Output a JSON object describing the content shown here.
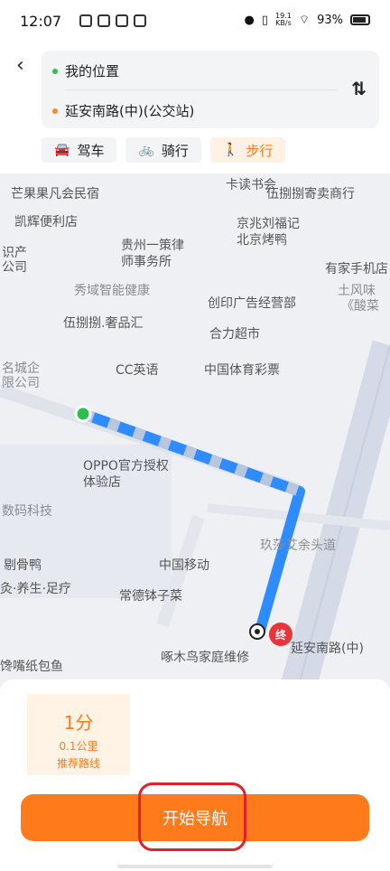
{
  "status_bar": {
    "time": "12:07",
    "net_speed": "19.1\nKB/s",
    "battery": "93%"
  },
  "header": {
    "back_icon": "chevron-left-icon",
    "start": "我的位置",
    "end": "延安南路(中)(公交站)",
    "swap_icon": "swap-icon",
    "modes": [
      {
        "label": "驾车",
        "icon": "car-icon"
      },
      {
        "label": "骑行",
        "icon": "bike-icon"
      },
      {
        "label": "步行",
        "icon": "walk-icon"
      }
    ],
    "active_mode": "步行"
  },
  "map": {
    "pois": [
      {
        "label": "芒果果凡会民宿"
      },
      {
        "label": "卡读书会"
      },
      {
        "label": "伍捌捌寄卖商行"
      },
      {
        "label": "凯辉便利店"
      },
      {
        "label": "京兆刘福记"
      },
      {
        "label": "北京烤鸭"
      },
      {
        "label": "贵州一策律"
      },
      {
        "label": "师事务所"
      },
      {
        "label": "识产"
      },
      {
        "label": "公司"
      },
      {
        "label": "有家手机店"
      },
      {
        "label": "秀域智能健康"
      },
      {
        "label": "土风味"
      },
      {
        "label": "《酸菜"
      },
      {
        "label": "创印广告经营部"
      },
      {
        "label": "伍捌捌.奢品汇"
      },
      {
        "label": "合力超市"
      },
      {
        "label": "名城企"
      },
      {
        "label": "限公司"
      },
      {
        "label": "CC英语"
      },
      {
        "label": "中国体育彩票"
      },
      {
        "label": "OPPO官方授权"
      },
      {
        "label": "体验店"
      },
      {
        "label": "数码科技"
      },
      {
        "label": "玖莎艾余头道"
      },
      {
        "label": "剔骨鸭"
      },
      {
        "label": "中国移动"
      },
      {
        "label": "灸·养生·足疗"
      },
      {
        "label": "常德钵子菜"
      },
      {
        "label": "啄木鸟家庭维修"
      },
      {
        "label": "延安南路(中)"
      },
      {
        "label": "馋嘴纸包鱼"
      }
    ],
    "end_marker": "终"
  },
  "summary": {
    "time": "1分",
    "distance": "0.1公里",
    "label": "推荐路线"
  },
  "nav_button": {
    "label": "开始导航"
  },
  "colors": {
    "accent": "#ff7a1a",
    "route": "#2f8cff",
    "start_dot": "#2bbf4c",
    "end_marker": "#e8343a"
  }
}
